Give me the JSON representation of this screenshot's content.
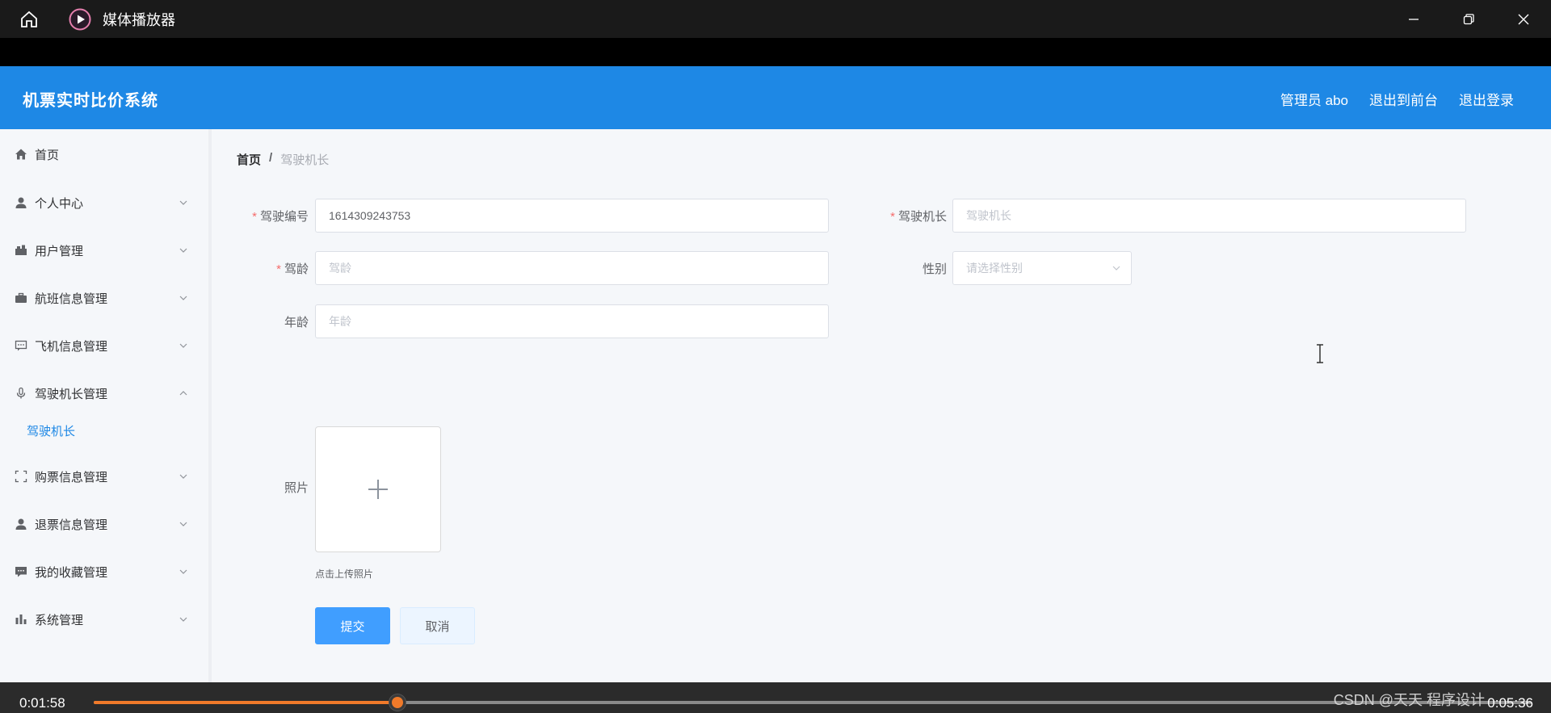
{
  "player": {
    "title": "媒体播放器",
    "current_time": "0:01:58",
    "total_time": "0:05:36",
    "progress": 0.211,
    "watermark": "CSDN @天天 程序设计"
  },
  "header": {
    "system_title": "机票实时比价系统",
    "admin_label": "管理员 abo",
    "back_to_front": "退出到前台",
    "logout": "退出登录"
  },
  "sidebar": {
    "items": [
      {
        "label": "首页",
        "icon": "home-icon",
        "expandable": false
      },
      {
        "label": "个人中心",
        "icon": "user-icon",
        "expandable": true
      },
      {
        "label": "用户管理",
        "icon": "briefcase-icon",
        "expandable": true
      },
      {
        "label": "航班信息管理",
        "icon": "suitcase-icon",
        "expandable": true
      },
      {
        "label": "飞机信息管理",
        "icon": "chat-icon",
        "expandable": true
      },
      {
        "label": "驾驶机长管理",
        "icon": "microphone-icon",
        "expandable": true,
        "expanded": true
      },
      {
        "label": "购票信息管理",
        "icon": "fullscreen-icon",
        "expandable": true
      },
      {
        "label": "退票信息管理",
        "icon": "user-icon",
        "expandable": true
      },
      {
        "label": "我的收藏管理",
        "icon": "message-icon",
        "expandable": true
      },
      {
        "label": "系统管理",
        "icon": "chart-icon",
        "expandable": true
      }
    ],
    "sub_item": "驾驶机长"
  },
  "breadcrumb": {
    "home": "首页",
    "separator": "/",
    "current": "驾驶机长"
  },
  "form": {
    "pilot_no_label": "驾驶编号",
    "pilot_no_value": "1614309243753",
    "captain_label": "驾驶机长",
    "captain_placeholder": "驾驶机长",
    "years_label": "驾龄",
    "years_placeholder": "驾龄",
    "gender_label": "性别",
    "gender_placeholder": "请选择性别",
    "age_label": "年龄",
    "age_placeholder": "年龄",
    "photo_label": "照片",
    "upload_tip": "点击上传照片",
    "required_mark": "*",
    "submit": "提交",
    "cancel": "取消"
  },
  "colors": {
    "brand": "#1e88e5",
    "primary_button": "#409eff",
    "progress": "#f07a2a",
    "required": "#f56c6c"
  }
}
